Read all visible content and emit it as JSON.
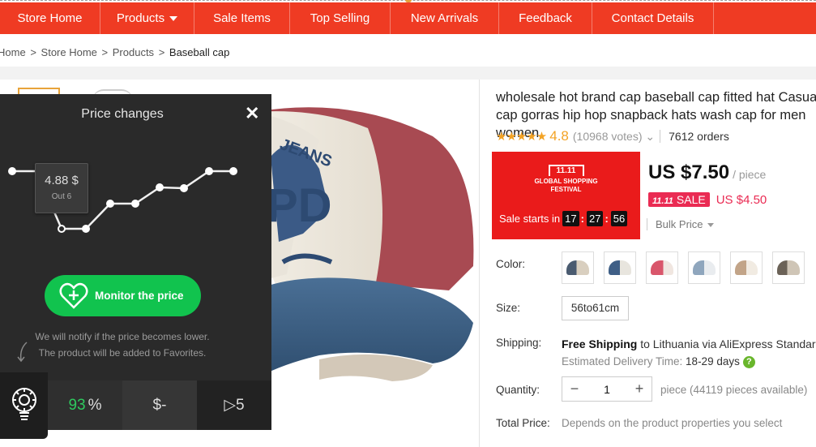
{
  "nav": {
    "items": [
      {
        "label": "Store Home"
      },
      {
        "label": "Products",
        "caret": true
      },
      {
        "label": "Sale Items"
      },
      {
        "label": "Top Selling"
      },
      {
        "label": "New Arrivals"
      },
      {
        "label": "Feedback"
      },
      {
        "label": "Contact Details"
      }
    ]
  },
  "breadcrumb": {
    "items": [
      "Home",
      "Store Home",
      "Products",
      "Baseball cap"
    ],
    "separator": ">"
  },
  "product": {
    "title": "wholesale hot brand cap baseball cap fitted hat Casual cap gorras hip hop snapback hats wash cap for men women",
    "stars": "★★★★★",
    "rating": "4.8",
    "votes": "(10968 votes)",
    "votes_caret": "⌄",
    "orders": "7612 orders",
    "promo": {
      "logo_top": "11.11",
      "logo_line1": "GLOBAL SHOPPING",
      "logo_line2": "FESTIVAL",
      "sale_starts": "Sale starts in",
      "hh": "17",
      "mm": "27",
      "ss": "56"
    },
    "price": "US $7.50",
    "price_unit": "/ piece",
    "sale_badge_prefix": "11.11",
    "sale_badge": "SALE",
    "sale_price": "US $4.50",
    "bulk_price": "Bulk Price",
    "color_label": "Color:",
    "size_label": "Size:",
    "size_value": "56to61cm",
    "shipping_label": "Shipping:",
    "shipping_free": "Free Shipping",
    "shipping_rest": " to Lithuania via AliExpress Standard Shipping",
    "delivery_label": "Estimated Delivery Time: ",
    "delivery_days": "18-29 days",
    "help": "?",
    "quantity_label": "Quantity:",
    "qty_minus": "−",
    "qty_value": "1",
    "qty_plus": "+",
    "qty_available": "piece (44119 pieces available)",
    "total_label": "Total Price:",
    "total_value": "Depends on the product properties you select",
    "colors": [
      "#c8b9a0",
      "#3f5f86",
      "#d9566b",
      "#8fa6bd",
      "#c2a488",
      "#9b8f80"
    ]
  },
  "price_panel": {
    "title": "Price changes",
    "close": "✕",
    "tooltip_value": "4.88 $",
    "tooltip_date": "Out 6",
    "monitor_label": "Monitor the price",
    "notify_line1": "We will notify if the price becomes lower.",
    "notify_line2": "The product will be added to Favorites.",
    "stat_percent": "93",
    "stat_percent_sign": "%",
    "stat_dollar": "$-",
    "stat_views": "▷5"
  },
  "colors": {
    "nav_bg": "#ef3b23",
    "accent_orange": "#f3a325",
    "sale_pink": "#ea2b53",
    "monitor_green": "#11c34e",
    "panel_bg": "#2a2a2a"
  }
}
